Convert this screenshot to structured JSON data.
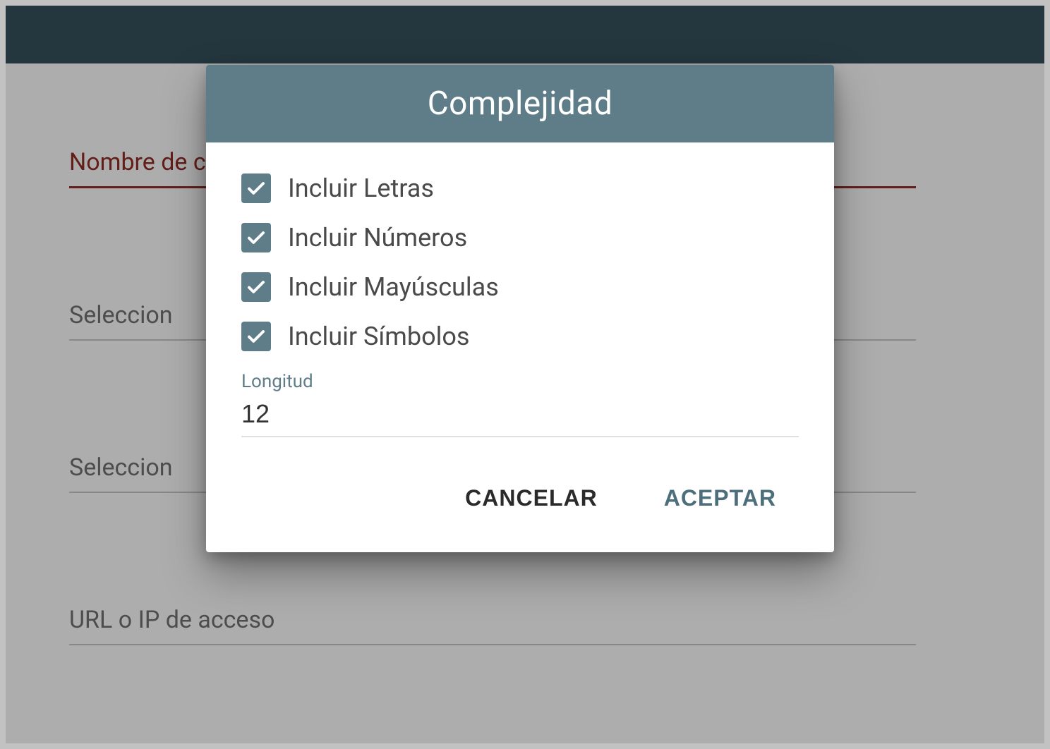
{
  "colors": {
    "accent": "#5e7d89",
    "topbar": "#324b56",
    "error": "#8a2a25"
  },
  "background": {
    "fields": [
      {
        "label": "Nombre de c",
        "error": true
      },
      {
        "label": "Seleccion",
        "error": false
      },
      {
        "label": "Seleccion",
        "error": false
      },
      {
        "label": "URL o IP de acceso",
        "error": false
      }
    ]
  },
  "dialog": {
    "title": "Complejidad",
    "options": [
      {
        "label": "Incluir Letras",
        "checked": true
      },
      {
        "label": "Incluir Números",
        "checked": true
      },
      {
        "label": "Incluir Mayúsculas",
        "checked": true
      },
      {
        "label": "Incluir Símbolos",
        "checked": true
      }
    ],
    "length": {
      "label": "Longitud",
      "value": "12"
    },
    "actions": {
      "cancel": "CANCELAR",
      "accept": "ACEPTAR"
    }
  }
}
